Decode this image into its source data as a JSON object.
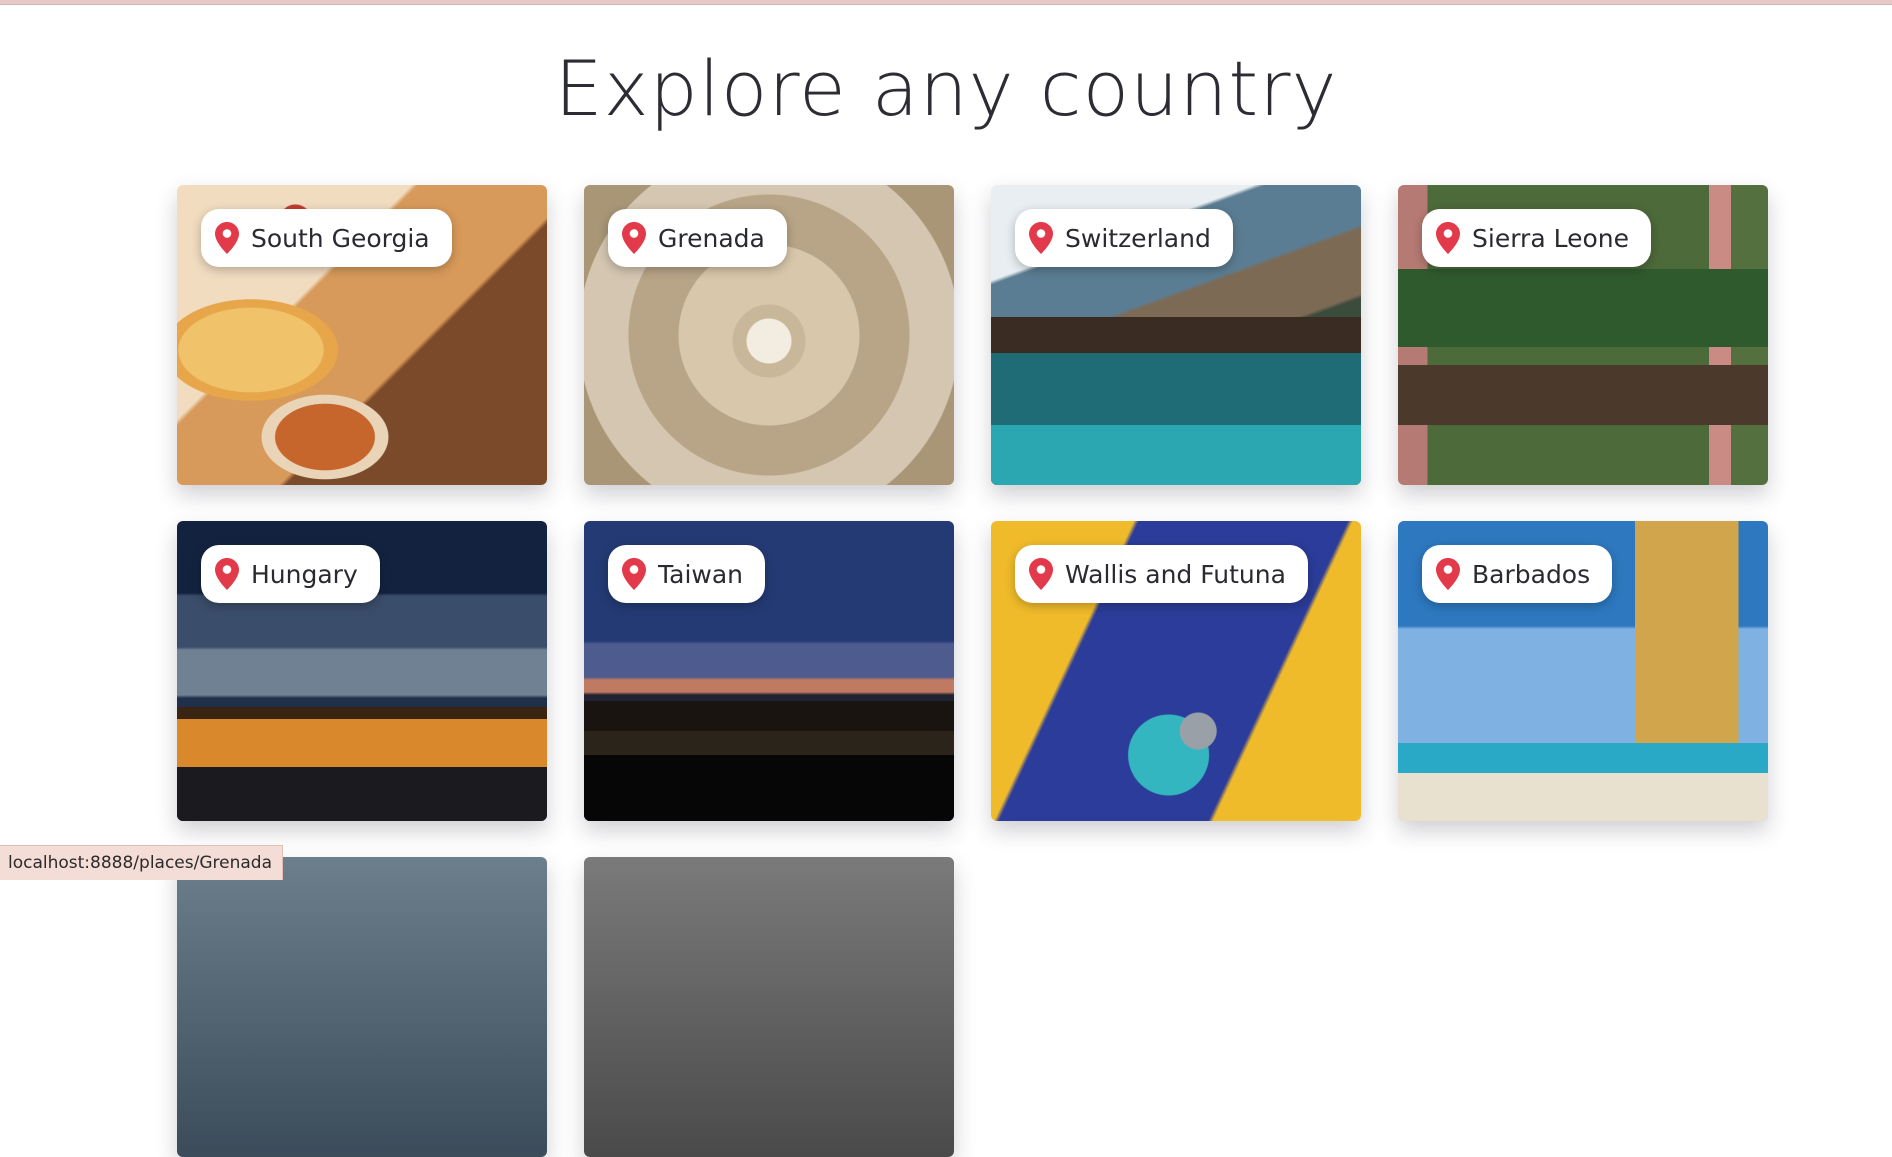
{
  "page": {
    "title": "Explore any country"
  },
  "countries": [
    {
      "name": "South Georgia",
      "image": "food"
    },
    {
      "name": "Grenada",
      "image": "dome"
    },
    {
      "name": "Switzerland",
      "image": "swiss"
    },
    {
      "name": "Sierra Leone",
      "image": "sierra"
    },
    {
      "name": "Hungary",
      "image": "hungary"
    },
    {
      "name": "Taiwan",
      "image": "taiwan"
    },
    {
      "name": "Wallis and Futuna",
      "image": "pedal"
    },
    {
      "name": "Barbados",
      "image": "barbados"
    }
  ],
  "status_bar": {
    "url": "localhost:8888/places/Grenada"
  },
  "icons": {
    "location": "map-pin-icon"
  },
  "colors": {
    "pin": "#e23a4a",
    "title": "#2c2c34"
  }
}
